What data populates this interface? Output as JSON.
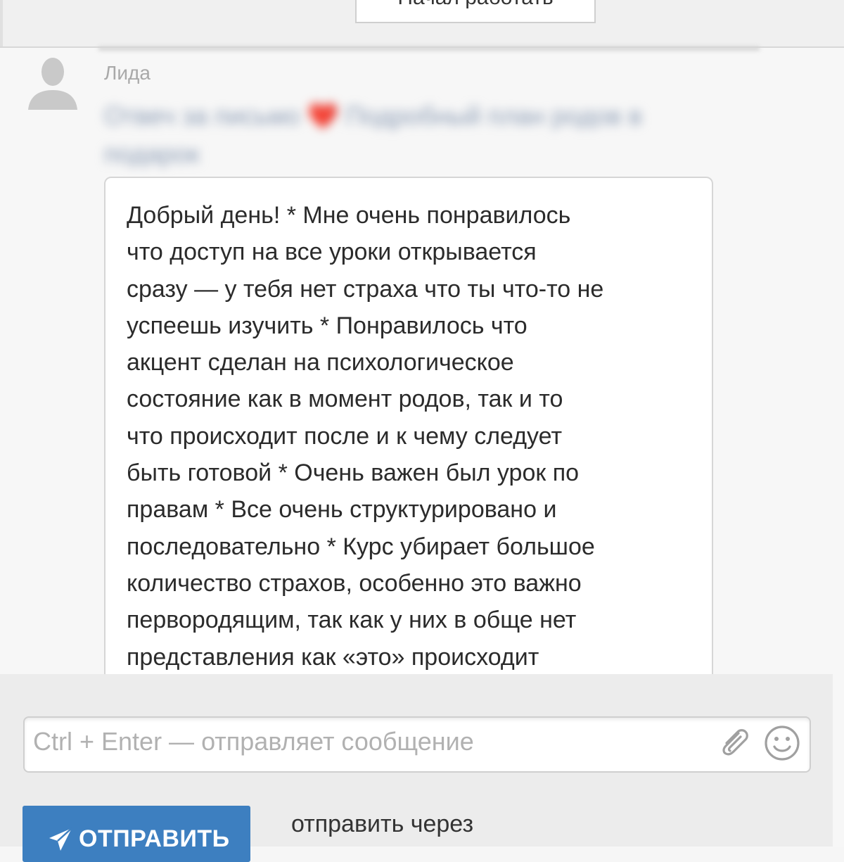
{
  "top_bar": {
    "start_button_label": "Начал работать"
  },
  "message": {
    "sender_name": "Лида",
    "quoted_preview_blurred": "Отвеч за письмо ❤️ Подробный план родов в подарок",
    "body_lines": [
      "Добрый день! * Мне очень понравилось",
      "что доступ на все уроки открывается",
      "сразу  — у тебя нет страха что ты что-то не",
      "успеешь изучить *  Понравилось что",
      "акцент сделан на психологическое",
      "состояние как в момент родов, так и то",
      "что происходит после и к чему следует",
      "быть готовой * Очень важен был урок по",
      "правам * Все очень структурировано и",
      "последовательно * Курс убирает большое",
      "количество страхов, особенно это важно",
      "первородящим, так как у них в обще нет",
      "представления как «это» происходит"
    ]
  },
  "composer": {
    "placeholder": "Ctrl + Enter — отправляет сообщение",
    "attach_icon": "paperclip-icon",
    "emoji_icon": "smiley-icon",
    "send_button_label": "ОТПРАВИТЬ",
    "send_icon": "paper-plane-icon",
    "send_via_label": "отправить через"
  },
  "colors": {
    "send_button": "#3d7fc0",
    "background": "#f7f7f7",
    "placeholder_text": "#b1b1b1",
    "sender_name": "#a9a9a9"
  }
}
